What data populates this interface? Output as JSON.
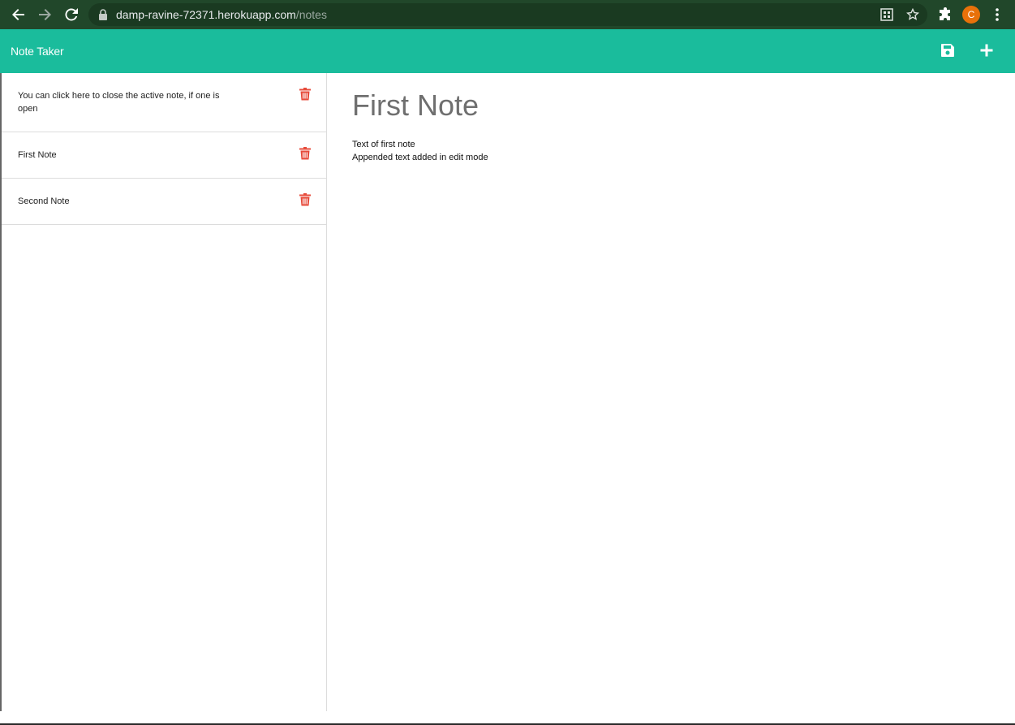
{
  "browser": {
    "url_host": "damp-ravine-72371.herokuapp.com",
    "url_path": "/notes",
    "avatar_letter": "C",
    "icons": [
      "back-arrow-icon",
      "forward-arrow-icon",
      "reload-icon",
      "lock-icon",
      "qr-code-icon",
      "star-icon",
      "extensions-puzzle-icon",
      "kebab-menu-icon"
    ]
  },
  "navbar": {
    "title": "Note Taker",
    "save_icon": "save-icon",
    "new_icon": "plus-icon",
    "background_color": "#1abc9c"
  },
  "sidebar": {
    "items": [
      {
        "label": "You can click here to close the active note, if one is open",
        "icon": "trash-icon"
      },
      {
        "label": "First Note",
        "icon": "trash-icon"
      },
      {
        "label": "Second Note",
        "icon": "trash-icon"
      }
    ],
    "delete_icon_color": "#e74c3c"
  },
  "note": {
    "title": "First Note",
    "body": "Text of first note\nAppended text added in edit mode"
  }
}
